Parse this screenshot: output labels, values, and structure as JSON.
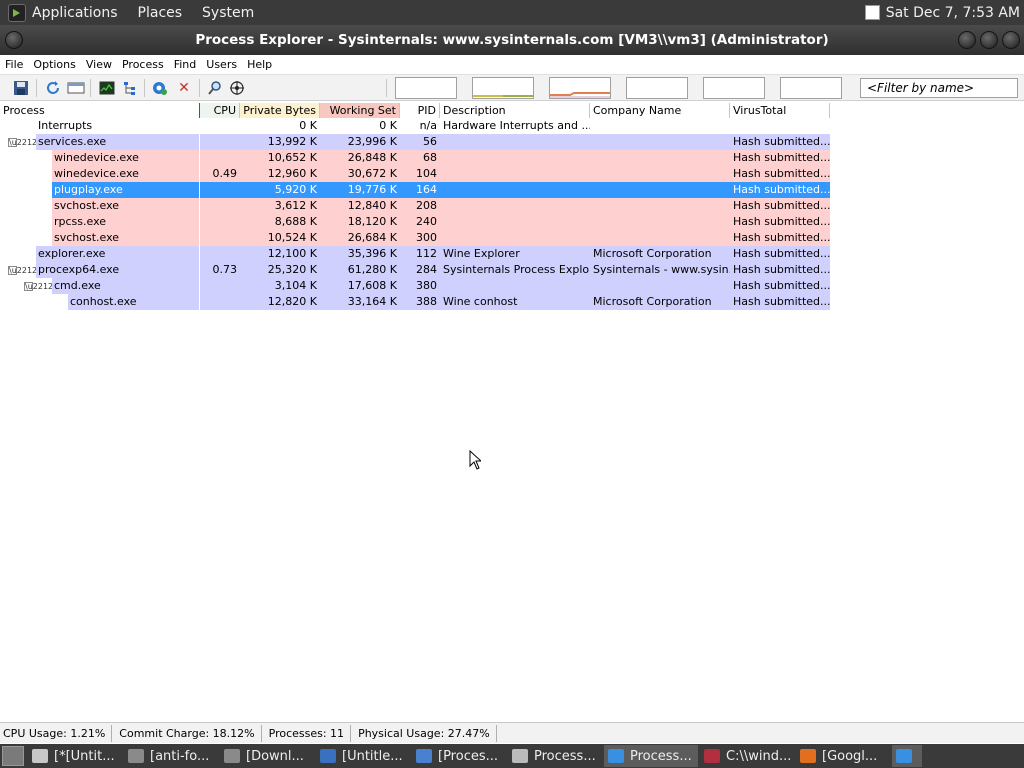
{
  "top_panel": {
    "menus": [
      "Applications",
      "Places",
      "System"
    ],
    "clock": "Sat Dec 7, 7:53 AM"
  },
  "window": {
    "title": "Process Explorer - Sysinternals: www.sysinternals.com [VM3\\\\vm3] (Administrator)"
  },
  "menubar": [
    "File",
    "Options",
    "View",
    "Process",
    "Find",
    "Users",
    "Help"
  ],
  "toolbar": {
    "filter_placeholder": "<Filter by name>",
    "icons": [
      "save-icon",
      "refresh-icon",
      "window-icon",
      "system-info-icon",
      "tree-icon",
      "target-icon",
      "kill-icon",
      "find-icon",
      "crosshair-icon"
    ]
  },
  "columns": {
    "process": "Process",
    "cpu": "CPU",
    "private_bytes": "Private Bytes",
    "working_set": "Working Set",
    "pid": "PID",
    "description": "Description",
    "company": "Company Name",
    "virustotal": "VirusTotal"
  },
  "processes": [
    {
      "name": "Interrupts",
      "cpu": "",
      "private": "0 K",
      "ws": "0 K",
      "pid": "n/a",
      "desc": "Hardware Interrupts and ...",
      "company": "",
      "vt": ""
    },
    {
      "name": "services.exe",
      "cpu": "",
      "private": "13,992 K",
      "ws": "23,996 K",
      "pid": "56",
      "desc": "",
      "company": "",
      "vt": "Hash submitted..."
    },
    {
      "name": "winedevice.exe",
      "cpu": "",
      "private": "10,652 K",
      "ws": "26,848 K",
      "pid": "68",
      "desc": "",
      "company": "",
      "vt": "Hash submitted..."
    },
    {
      "name": "winedevice.exe",
      "cpu": "0.49",
      "private": "12,960 K",
      "ws": "30,672 K",
      "pid": "104",
      "desc": "",
      "company": "",
      "vt": "Hash submitted..."
    },
    {
      "name": "plugplay.exe",
      "cpu": "",
      "private": "5,920 K",
      "ws": "19,776 K",
      "pid": "164",
      "desc": "",
      "company": "",
      "vt": "Hash submitted..."
    },
    {
      "name": "svchost.exe",
      "cpu": "",
      "private": "3,612 K",
      "ws": "12,840 K",
      "pid": "208",
      "desc": "",
      "company": "",
      "vt": "Hash submitted..."
    },
    {
      "name": "rpcss.exe",
      "cpu": "",
      "private": "8,688 K",
      "ws": "18,120 K",
      "pid": "240",
      "desc": "",
      "company": "",
      "vt": "Hash submitted..."
    },
    {
      "name": "svchost.exe",
      "cpu": "",
      "private": "10,524 K",
      "ws": "26,684 K",
      "pid": "300",
      "desc": "",
      "company": "",
      "vt": "Hash submitted..."
    },
    {
      "name": "explorer.exe",
      "cpu": "",
      "private": "12,100 K",
      "ws": "35,396 K",
      "pid": "112",
      "desc": "Wine Explorer",
      "company": "Microsoft Corporation",
      "vt": "Hash submitted..."
    },
    {
      "name": "procexp64.exe",
      "cpu": "0.73",
      "private": "25,320 K",
      "ws": "61,280 K",
      "pid": "284",
      "desc": "Sysinternals Process Explo...",
      "company": "Sysinternals - www.sysin...",
      "vt": "Hash submitted..."
    },
    {
      "name": "cmd.exe",
      "cpu": "",
      "private": "3,104 K",
      "ws": "17,608 K",
      "pid": "380",
      "desc": "",
      "company": "",
      "vt": "Hash submitted..."
    },
    {
      "name": "conhost.exe",
      "cpu": "",
      "private": "12,820 K",
      "ws": "33,164 K",
      "pid": "388",
      "desc": "Wine conhost",
      "company": "Microsoft Corporation",
      "vt": "Hash submitted..."
    }
  ],
  "status": {
    "cpu": "CPU Usage: 1.21%",
    "commit": "Commit Charge: 18.12%",
    "processes": "Processes: 11",
    "physical": "Physical Usage: 27.47%"
  },
  "taskbar": [
    {
      "label": "[*[Untit...",
      "icon": "text-editor-icon"
    },
    {
      "label": "[anti-fo...",
      "icon": "folder-icon"
    },
    {
      "label": "[Downl...",
      "icon": "folder-icon"
    },
    {
      "label": "[Untitle...",
      "icon": "app-icon"
    },
    {
      "label": "[Proces...",
      "icon": "browser-icon"
    },
    {
      "label": "Process...",
      "icon": "window-icon"
    },
    {
      "label": "Process...",
      "icon": "procexp-icon",
      "active": true
    },
    {
      "label": "C:\\\\wind...",
      "icon": "wine-icon"
    },
    {
      "label": "[Googl...",
      "icon": "firefox-icon"
    }
  ],
  "colors": {
    "services_blue": "#d0d0ff",
    "services_pink": "#ffd0d0",
    "selection": "#3399ff"
  }
}
